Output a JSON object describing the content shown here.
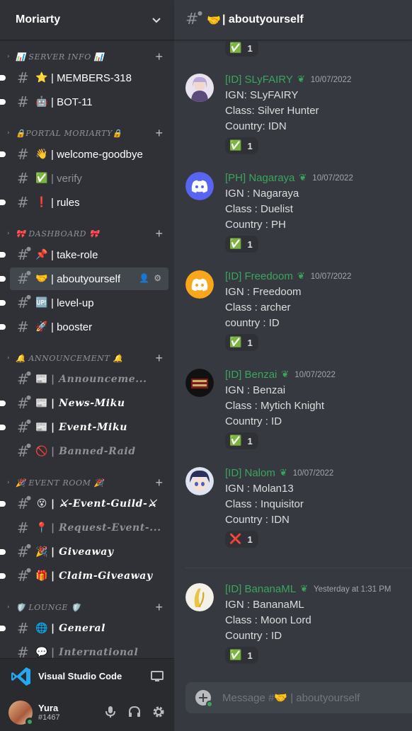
{
  "server": {
    "name": "Moriarty"
  },
  "sidebar": {
    "categories": [
      {
        "label": "📊 SERVER INFO 📊"
      },
      {
        "label": "🔒PORTAL MORIARTY🔒"
      },
      {
        "label": "🎀 DASHBOARD 🎀"
      },
      {
        "label": "🔔 ANNOUNCEMENT 🔔"
      },
      {
        "label": "🎉 EVENT ROOM 🎉"
      },
      {
        "label": "🛡️ LOUNGE 🛡️"
      }
    ],
    "channels": [
      {
        "emoji": "⭐",
        "name": "| MEMBERS-318"
      },
      {
        "emoji": "🤖",
        "name": "| BOT-11"
      },
      {
        "emoji": "👋",
        "name": "| welcome-goodbye"
      },
      {
        "emoji": "✅",
        "name": "| verify"
      },
      {
        "emoji": "❗",
        "name": "| rules"
      },
      {
        "emoji": "📌",
        "name": "| take-role"
      },
      {
        "emoji": "🤝",
        "name": "| aboutyourself"
      },
      {
        "emoji": "🆙",
        "name": "| level-up"
      },
      {
        "emoji": "🚀",
        "name": "| booster"
      },
      {
        "emoji": "📰",
        "name": "| Announceme..."
      },
      {
        "emoji": "📰",
        "name": "| News-Miku"
      },
      {
        "emoji": "📰",
        "name": "| Event-Miku"
      },
      {
        "emoji": "🚫",
        "name": "| Banned-Raid"
      },
      {
        "emoji": "😵",
        "name": "| ⚔-Event-Guild-⚔"
      },
      {
        "emoji": "📍",
        "name": "| Request-Event-..."
      },
      {
        "emoji": "🎉",
        "name": "| Giveaway"
      },
      {
        "emoji": "🎁",
        "name": "| Claim-Giveaway"
      },
      {
        "emoji": "🌐",
        "name": "| General"
      },
      {
        "emoji": "💬",
        "name": "| International"
      }
    ]
  },
  "activity": {
    "app": "Visual Studio Code"
  },
  "user": {
    "name": "Yura",
    "tag": "#1467"
  },
  "channel_header": {
    "emoji": "🤝",
    "title": "| aboutyourself"
  },
  "top_reaction": {
    "emoji": "✅",
    "count": "1"
  },
  "messages": [
    {
      "username": "[ID] SLyFAIRY",
      "badge": "❦",
      "timestamp": "10/07/2022",
      "lines": [
        "IGN: SLyFAIRY",
        "Class: Silver Hunter",
        "Country: IDN"
      ],
      "reaction": {
        "emoji": "✅",
        "count": "1"
      }
    },
    {
      "username": "[PH] Nagaraya",
      "badge": "❦",
      "timestamp": "10/07/2022",
      "lines": [
        "IGN : Nagaraya",
        "Class : Duelist",
        "Country : PH"
      ],
      "reaction": {
        "emoji": "✅",
        "count": "1"
      }
    },
    {
      "username": "[ID] Freedoom",
      "badge": "❦",
      "timestamp": "10/07/2022",
      "lines": [
        "IGN : Freedoom",
        "Class : archer",
        "country : ID"
      ],
      "reaction": {
        "emoji": "✅",
        "count": "1"
      }
    },
    {
      "username": "[ID] Benzai",
      "badge": "❦",
      "timestamp": "10/07/2022",
      "lines": [
        "IGN : Benzai",
        "Class : Mytich Knight",
        "Country : ID"
      ],
      "reaction": {
        "emoji": "✅",
        "count": "1"
      }
    },
    {
      "username": "[ID] Nalom",
      "badge": "❦",
      "timestamp": "10/07/2022",
      "lines": [
        "IGN : Molan13",
        "Class : Inquisitor",
        "Country : IDN"
      ],
      "reaction": {
        "emoji": "❌",
        "count": "1"
      }
    },
    {
      "username": "[ID] BananaML",
      "badge": "❦",
      "timestamp": "Yesterday at 1:31 PM",
      "lines": [
        "IGN : BananaML",
        "Class : Moon Lord",
        "Country : ID"
      ],
      "reaction": {
        "emoji": "✅",
        "count": "1"
      }
    }
  ],
  "composer": {
    "placeholder": "Message #🤝 | aboutyourself"
  },
  "colors": {
    "accent_green": "#3ba55d",
    "blurple": "#5865f2",
    "orange": "#faa61a"
  }
}
